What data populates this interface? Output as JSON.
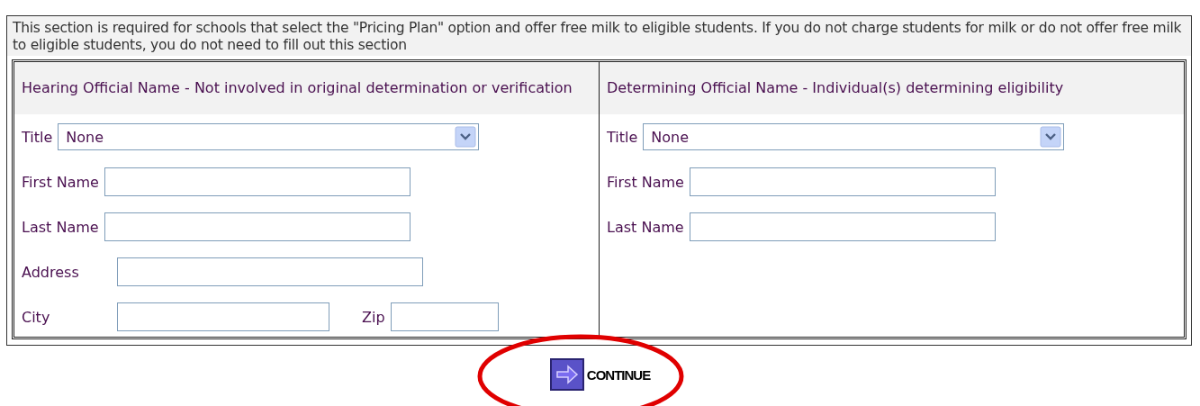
{
  "note": "This section is required for schools that select the \"Pricing Plan\" option and offer free milk to eligible students. If you do not charge students for milk or do not offer free milk to eligible students, you do not need to fill out this section",
  "columns": [
    {
      "heading": "Hearing Official Name - Not involved in original determination or verification",
      "title": {
        "label": "Title",
        "value": "None"
      },
      "fields": [
        {
          "label": "First Name"
        },
        {
          "label": "Last Name"
        },
        {
          "label": "Address"
        }
      ],
      "pair": [
        {
          "label": "City"
        },
        {
          "label": "Zip"
        }
      ]
    },
    {
      "heading": "Determining Official Name - Individual(s) determining eligibility",
      "title": {
        "label": "Title",
        "value": "None"
      },
      "fields": [
        {
          "label": "First Name"
        },
        {
          "label": "Last Name"
        }
      ]
    }
  ],
  "continue_button": {
    "label": "CONTINUE",
    "highlighted": true
  }
}
